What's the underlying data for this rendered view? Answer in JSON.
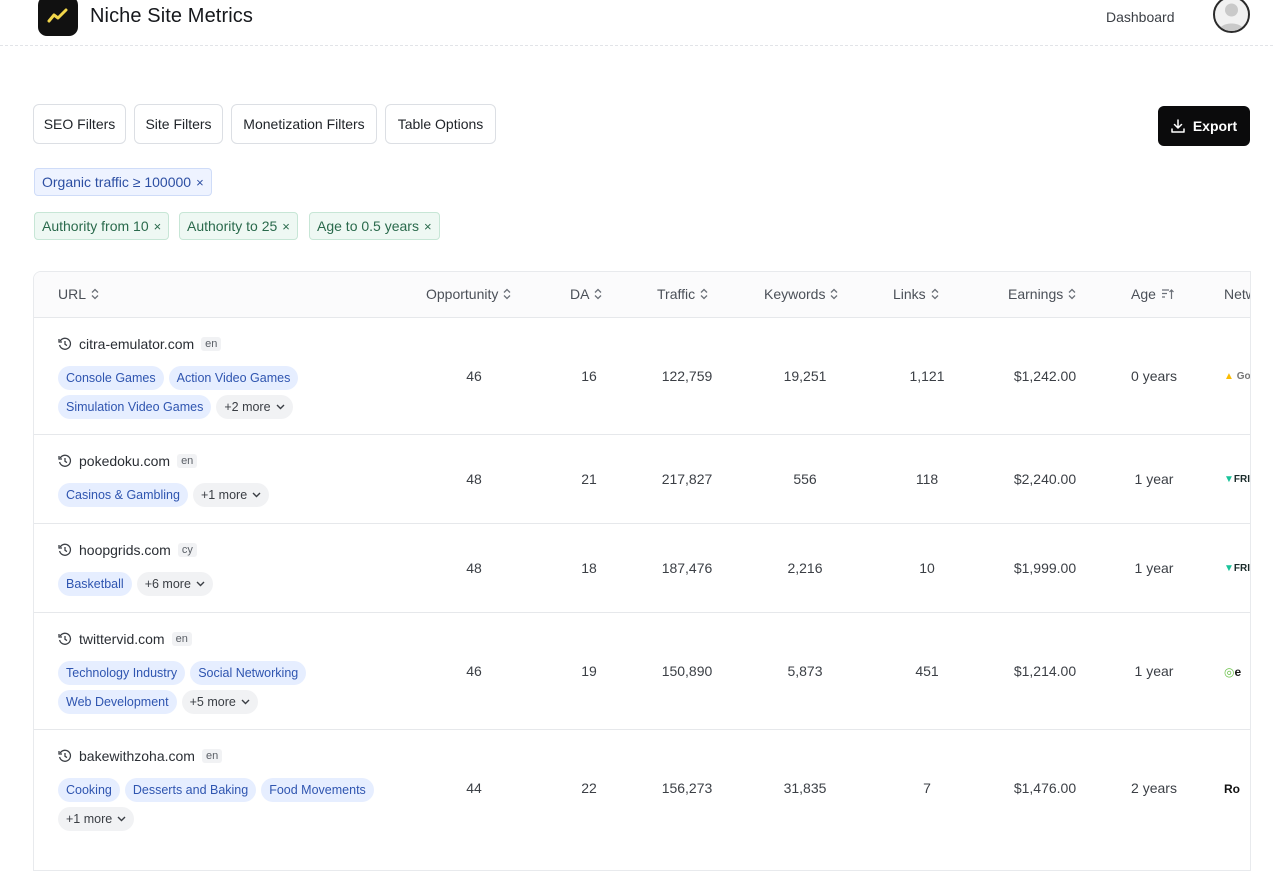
{
  "header": {
    "brand": "Niche Site Metrics",
    "nav_dashboard": "Dashboard"
  },
  "filters": {
    "seo": "SEO Filters",
    "site": "Site Filters",
    "monetization": "Monetization Filters",
    "table_options": "Table Options"
  },
  "export": {
    "label": "Export"
  },
  "active_filters": {
    "traffic": "Organic traffic ≥ 100000",
    "authority_from": "Authority from 10",
    "authority_to": "Authority to 25",
    "age_to": "Age to 0.5 years",
    "remove": "×"
  },
  "columns": {
    "url": "URL",
    "opportunity": "Opportunity",
    "da": "DA",
    "traffic": "Traffic",
    "keywords": "Keywords",
    "links": "Links",
    "earnings": "Earnings",
    "age": "Age",
    "network": "Netw"
  },
  "rows": [
    {
      "url": "citra-emulator.com",
      "lang": "en",
      "tags": [
        "Console Games",
        "Action Video Games",
        "Simulation Video Games"
      ],
      "more": "+2 more",
      "opportunity": "46",
      "da": "16",
      "traffic": "122,759",
      "keywords": "19,251",
      "links": "1,121",
      "earnings": "$1,242.00",
      "age": "0 years",
      "network": "Goo"
    },
    {
      "url": "pokedoku.com",
      "lang": "en",
      "tags": [
        "Casinos & Gambling"
      ],
      "more": "+1 more",
      "opportunity": "48",
      "da": "21",
      "traffic": "217,827",
      "keywords": "556",
      "links": "118",
      "earnings": "$2,240.00",
      "age": "1 year",
      "network": "FRI"
    },
    {
      "url": "hoopgrids.com",
      "lang": "cy",
      "tags": [
        "Basketball"
      ],
      "more": "+6 more",
      "opportunity": "48",
      "da": "18",
      "traffic": "187,476",
      "keywords": "2,216",
      "links": "10",
      "earnings": "$1,999.00",
      "age": "1 year",
      "network": "FRI"
    },
    {
      "url": "twittervid.com",
      "lang": "en",
      "tags": [
        "Technology Industry",
        "Social Networking",
        "Web Development"
      ],
      "more": "+5 more",
      "opportunity": "46",
      "da": "19",
      "traffic": "150,890",
      "keywords": "5,873",
      "links": "451",
      "earnings": "$1,214.00",
      "age": "1 year",
      "network": "e"
    },
    {
      "url": "bakewithzoha.com",
      "lang": "en",
      "tags": [
        "Cooking",
        "Desserts and Baking",
        "Food Movements"
      ],
      "more": "+1 more",
      "opportunity": "44",
      "da": "22",
      "traffic": "156,273",
      "keywords": "31,835",
      "links": "7",
      "earnings": "$1,476.00",
      "age": "2 years",
      "network": "Ro"
    }
  ]
}
